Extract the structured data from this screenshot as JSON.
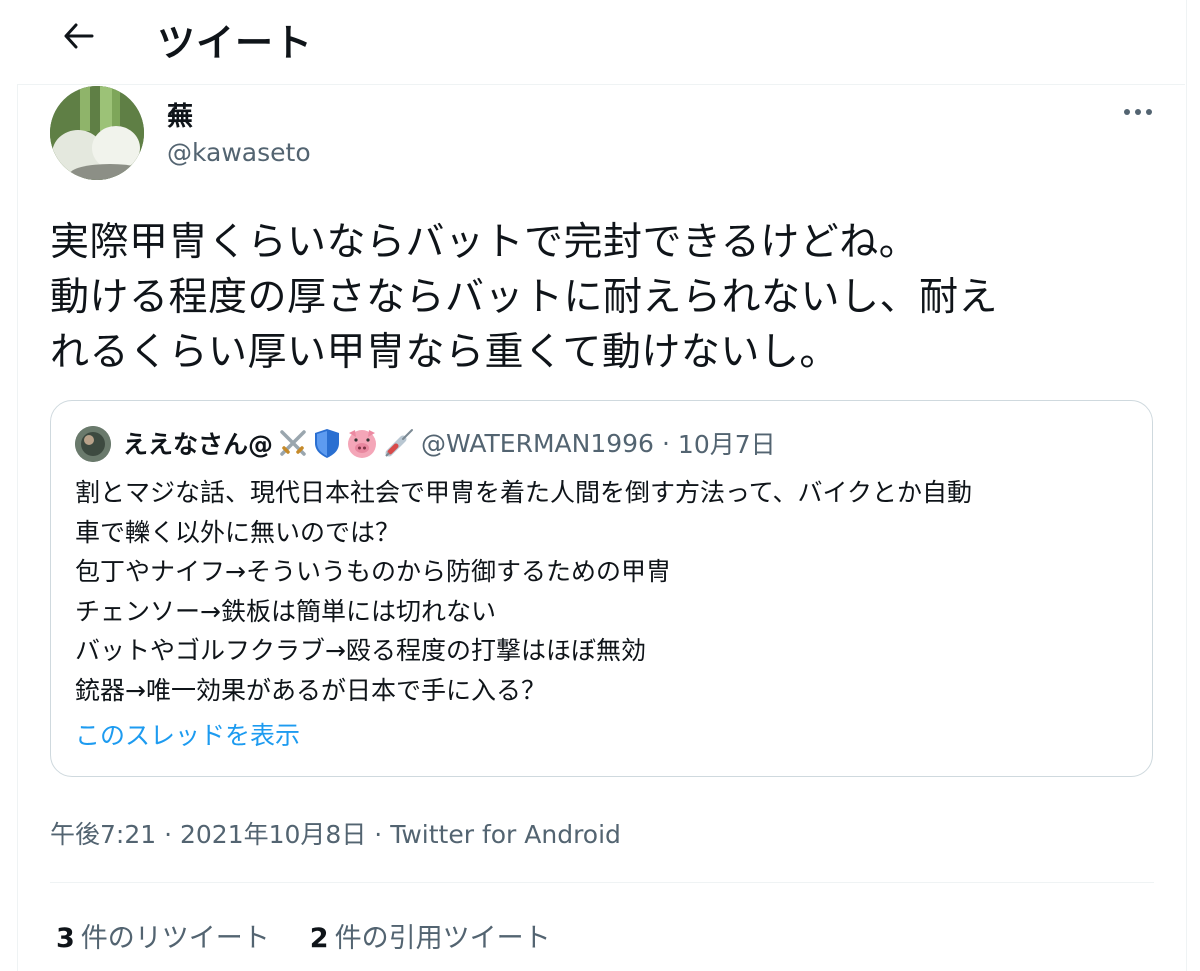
{
  "header": {
    "title": "ツイート",
    "back_icon": "arrow-left-icon"
  },
  "tweet": {
    "author": {
      "display_name": "蕪",
      "handle": "@kawaseto"
    },
    "text": "実際甲冑くらいならバットで完封できるけどね。\n動ける程度の厚さならバットに耐えられないし、耐え\nれるくらい厚い甲冑なら重くて動けないし。",
    "more_icon": "more-horizontal-icon",
    "time": "午後7:21",
    "date": "2021年10月8日",
    "client": "Twitter for Android",
    "separator": "·"
  },
  "quoted_tweet": {
    "display_name": "ええなさん@",
    "emoji_icons": [
      "crossed-swords-icon",
      "shield-icon",
      "pig-face-icon",
      "syringe-icon"
    ],
    "handle": "@WATERMAN1996",
    "separator": "·",
    "date": "10月7日",
    "text": "割とマジな話、現代日本社会で甲冑を着た人間を倒す方法って、バイクとか自動\n車で轢く以外に無いのでは？\n包丁やナイフ→そういうものから防御するための甲冑\nチェンソー→鉄板は簡単には切れない\nバットやゴルフクラブ→殴る程度の打撃はほぼ無効\n銃器→唯一効果があるが日本で手に入る？",
    "show_thread": "このスレッドを表示"
  },
  "stats": {
    "retweets_count": "3",
    "retweets_label": "件のリツイート",
    "quotes_count": "2",
    "quotes_label": "件の引用ツイート"
  },
  "colors": {
    "link": "#1d9bf0",
    "secondary_text": "#536471",
    "border": "#cfd9de"
  }
}
